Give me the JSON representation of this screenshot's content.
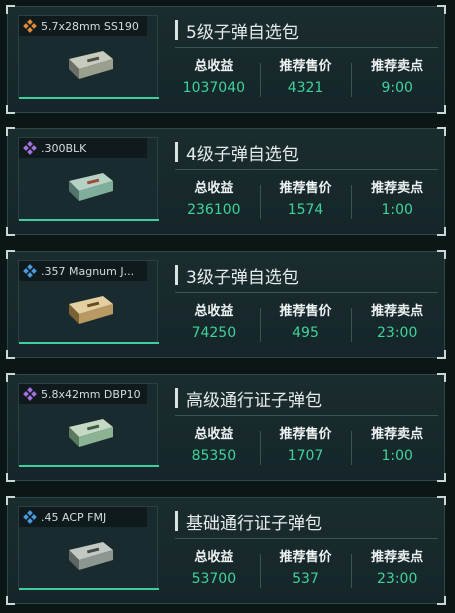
{
  "colors": {
    "background": "#0b1716",
    "card": "#1b2c2e",
    "accent_green": "#3fd39b",
    "text": "#e6ecec"
  },
  "stat_labels": {
    "revenue": "总收益",
    "price": "推荐售价",
    "time": "推荐卖点"
  },
  "cards": [
    {
      "item_name": "5.7x28mm SS190",
      "rarity": "orange",
      "rarity_icon": "orange-gem-icon",
      "rarity_color": "#e08a3c",
      "box_color": "#9aa08e",
      "title": "5级子弹自选包",
      "revenue": "1037040",
      "price": "4321",
      "time": "9:00"
    },
    {
      "item_name": ".300BLK",
      "rarity": "purple",
      "rarity_icon": "purple-gem-icon",
      "rarity_color": "#a572e0",
      "box_color": "#7fae9a",
      "title": "4级子弹自选包",
      "revenue": "236100",
      "price": "1574",
      "time": "1:00"
    },
    {
      "item_name": ".357 Magnum J...",
      "rarity": "blue",
      "rarity_icon": "blue-gem-icon",
      "rarity_color": "#4a9be0",
      "box_color": "#b89a62",
      "title": "3级子弹自选包",
      "revenue": "74250",
      "price": "495",
      "time": "23:00"
    },
    {
      "item_name": "5.8x42mm DBP10",
      "rarity": "purple",
      "rarity_icon": "purple-gem-icon",
      "rarity_color": "#a572e0",
      "box_color": "#8bb394",
      "title": "高级通行证子弹包",
      "revenue": "85350",
      "price": "1707",
      "time": "1:00"
    },
    {
      "item_name": ".45 ACP FMJ",
      "rarity": "blue",
      "rarity_icon": "blue-gem-icon",
      "rarity_color": "#4a9be0",
      "box_color": "#8e9690",
      "title": "基础通行证子弹包",
      "revenue": "53700",
      "price": "537",
      "time": "23:00"
    }
  ]
}
